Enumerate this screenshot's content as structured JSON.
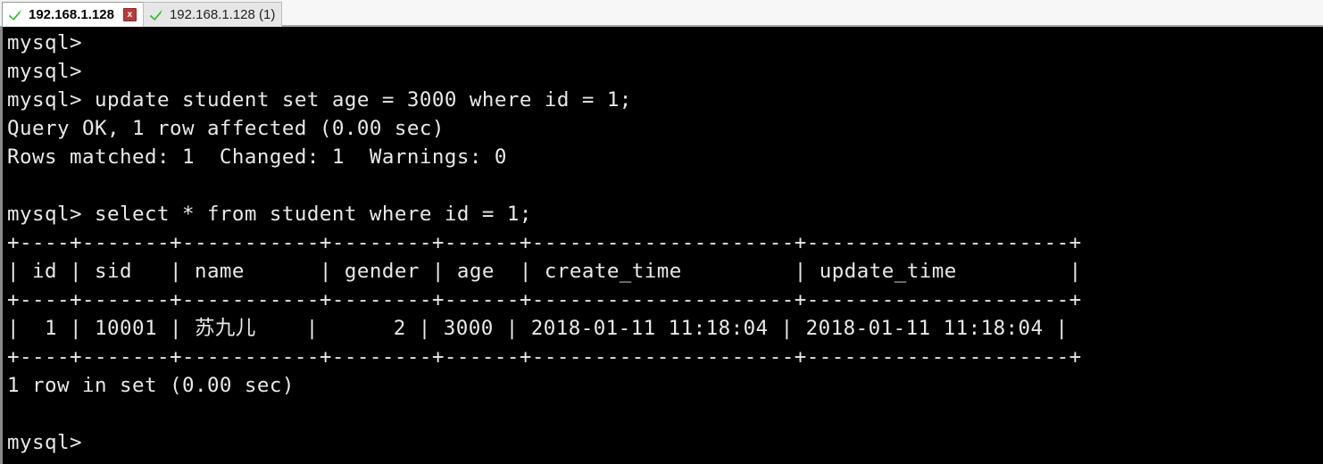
{
  "window": {
    "title": "192.168.1.128",
    "background_color": "#000000",
    "foreground_color": "#e9e9e9"
  },
  "tabbar": {
    "background_color": "#f2f2f2",
    "tabs": [
      {
        "label": "192.168.1.128",
        "status_icon": "green-check-icon",
        "status_color": "#2fbb2f",
        "active": true,
        "close_label": "x",
        "close_color": "#b53c3c"
      },
      {
        "label": "192.168.1.128 (1)",
        "status_icon": "green-check-icon",
        "status_color": "#2fbb2f",
        "active": false
      }
    ]
  },
  "terminal": {
    "prompt": "mysql>",
    "lines": [
      "mysql>",
      "mysql>",
      "mysql> update student set age = 3000 where id = 1;",
      "Query OK, 1 row affected (0.00 sec)",
      "Rows matched: 1  Changed: 1  Warnings: 0",
      "",
      "mysql> select * from student where id = 1;",
      "+----+-------+-----------+--------+------+---------------------+---------------------+",
      "| id | sid   | name      | gender | age  | create_time         | update_time         |",
      "+----+-------+-----------+--------+------+---------------------+---------------------+",
      "|  1 | 10001 | 苏九儿    |      2 | 3000 | 2018-01-11 11:18:04 | 2018-01-11 11:18:04 |",
      "+----+-------+-----------+--------+------+---------------------+---------------------+",
      "1 row in set (0.00 sec)",
      "",
      "mysql>"
    ],
    "query_result": {
      "columns": [
        "id",
        "sid",
        "name",
        "gender",
        "age",
        "create_time",
        "update_time"
      ],
      "rows": [
        [
          "1",
          "10001",
          "苏九儿",
          "2",
          "3000",
          "2018-01-11 11:18:04",
          "2018-01-11 11:18:04"
        ]
      ],
      "row_count_text": "1 row in set (0.00 sec)"
    },
    "update_result": {
      "status": "Query OK, 1 row affected (0.00 sec)",
      "rows_matched": "1",
      "changed": "1",
      "warnings": "0"
    }
  }
}
